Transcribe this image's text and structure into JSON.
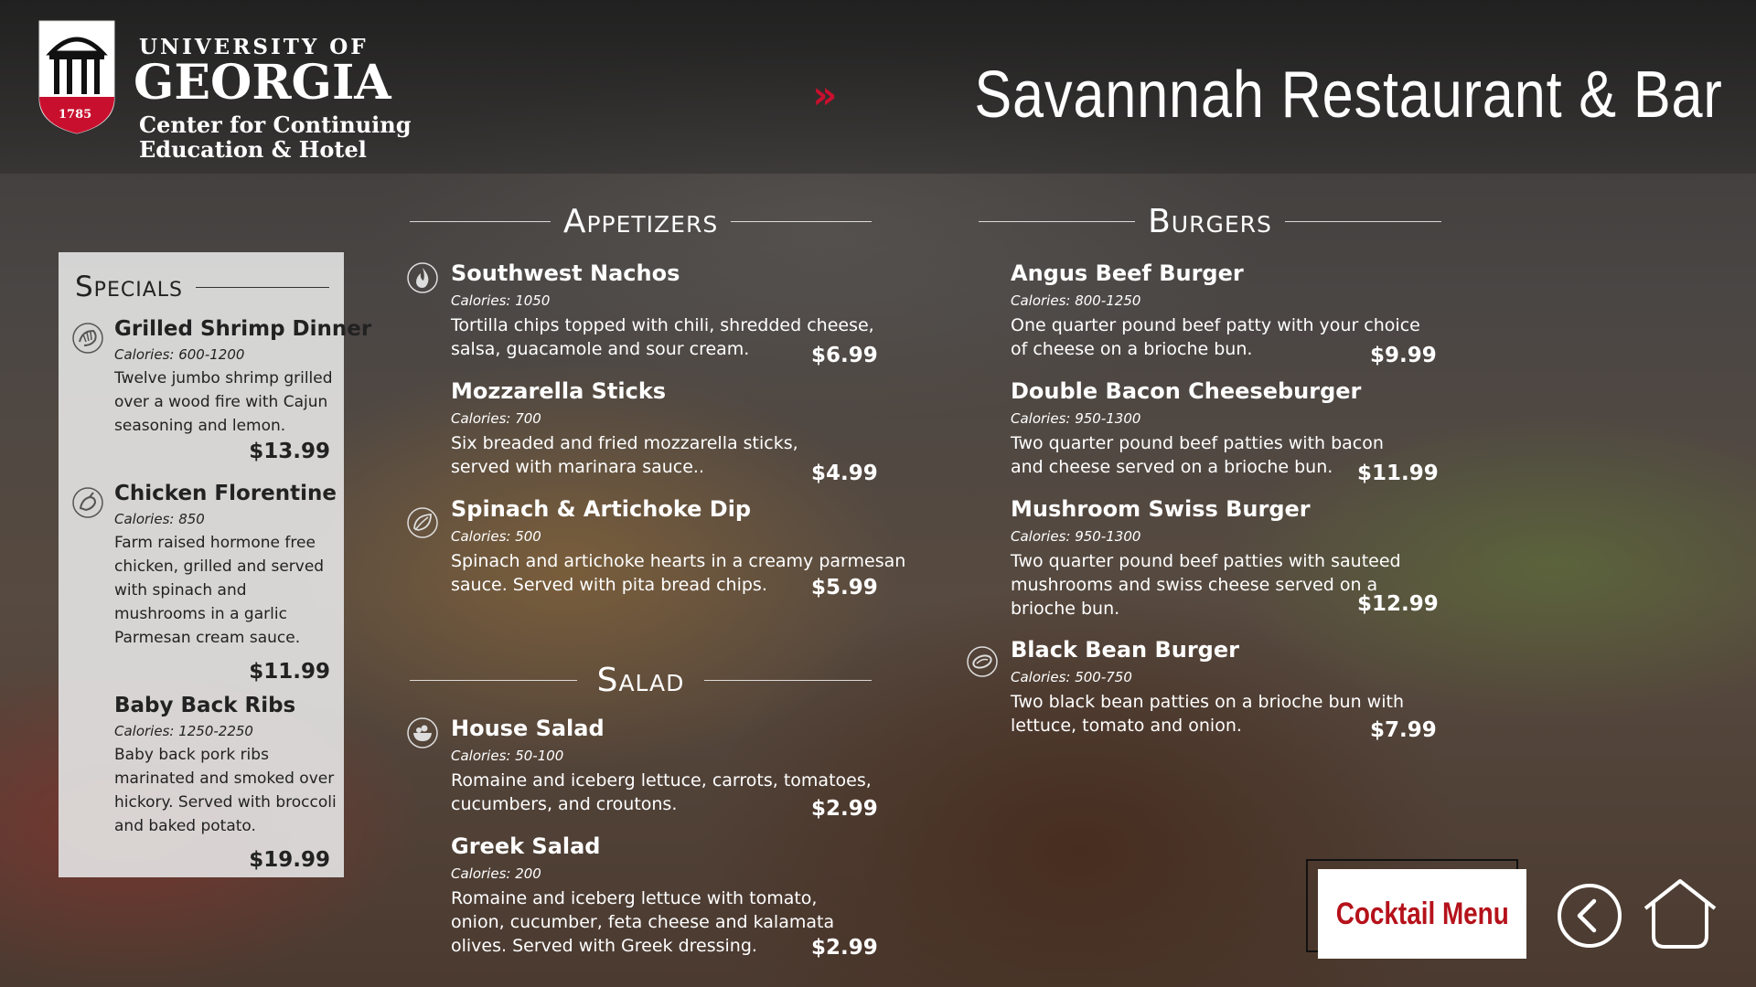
{
  "header": {
    "logo": {
      "line1": "UNIVERSITY OF",
      "line2": "GEORGIA",
      "line3": "Center for Continuing",
      "line4": "Education & Hotel",
      "year": "1785"
    },
    "chevrons": "»",
    "title": "Savannnah Restaurant & Bar"
  },
  "colors": {
    "accent_red": "#c8102e",
    "cocktail_text": "#b5121b",
    "panel_bg": "#e4e4e4"
  },
  "specials": {
    "title": "Specials",
    "items": [
      {
        "name": "Grilled Shrimp Dinner",
        "calories": "Calories: 600-1200",
        "description": "Twelve jumbo shrimp grilled over a wood fire with Cajun seasoning and lemon.",
        "price": "$13.99",
        "icon": "shrimp-icon"
      },
      {
        "name": "Chicken Florentine",
        "calories": "Calories: 850",
        "description": "Farm raised hormone free chicken, grilled and served with spinach and mushrooms in a garlic Parmesan cream sauce.",
        "price": "$11.99",
        "icon": "chicken-icon"
      },
      {
        "name": "Baby Back Ribs",
        "calories": "Calories: 1250-2250",
        "description": "Baby back pork ribs marinated and smoked over hickory. Served with broccoli and baked potato.",
        "price": "$19.99"
      }
    ]
  },
  "appetizers": {
    "title": "Appetizers",
    "items": [
      {
        "name": "Southwest Nachos",
        "calories": "Calories: 1050",
        "description": "Tortilla chips topped with chili, shredded cheese, salsa, guacamole and sour cream.",
        "price": "$6.99",
        "icon": "spicy-flame-icon"
      },
      {
        "name": "Mozzarella Sticks",
        "calories": "Calories: 700",
        "description": "Six breaded and fried mozzarella sticks, served with marinara sauce..",
        "price": "$4.99"
      },
      {
        "name": "Spinach & Artichoke Dip",
        "calories": "Calories: 500",
        "description": "Spinach and artichoke hearts in a creamy parmesan sauce. Served with pita bread chips.",
        "price": "$5.99",
        "icon": "vegetarian-leaf-icon"
      }
    ]
  },
  "salad": {
    "title": "Salad",
    "items": [
      {
        "name": "House Salad",
        "calories": "Calories: 50-100",
        "description": "Romaine and iceberg lettuce, carrots, tomatoes, cucumbers, and croutons.",
        "price": "$2.99",
        "icon": "salad-bowl-icon"
      },
      {
        "name": "Greek Salad",
        "calories": "Calories: 200",
        "description": "Romaine and iceberg lettuce with tomato, onion, cucumber, feta cheese and kalamata olives. Served with Greek dressing.",
        "price": "$2.99"
      }
    ]
  },
  "burgers": {
    "title": "Burgers",
    "items": [
      {
        "name": "Angus Beef Burger",
        "calories": "Calories: 800-1250",
        "description": "One quarter pound beef patty with your choice of cheese on a brioche bun.",
        "price": "$9.99"
      },
      {
        "name": "Double Bacon Cheeseburger",
        "calories": "Calories: 950-1300",
        "description": "Two quarter pound beef patties with bacon and cheese served on a brioche bun.",
        "price": "$11.99"
      },
      {
        "name": "Mushroom Swiss Burger",
        "calories": "Calories: 950-1300",
        "description": "Two quarter pound beef patties with sauteed mushrooms and swiss cheese served on a brioche bun.",
        "price": "$12.99"
      },
      {
        "name": "Black Bean Burger",
        "calories": "Calories: 500-750",
        "description": "Two black bean patties on a brioche bun with lettuce, tomato and onion.",
        "price": "$7.99",
        "icon": "bean-icon"
      }
    ]
  },
  "footer": {
    "cocktail_label": "Cocktail Menu"
  }
}
